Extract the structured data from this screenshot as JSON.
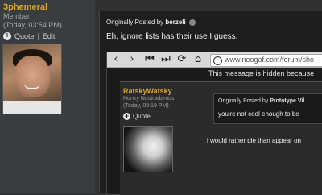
{
  "author": {
    "username": "3phemeral",
    "title": "Member",
    "time": "(Today, 03:54 PM)",
    "quote_label": "Quote",
    "separator": "|",
    "edit_label": "Edit"
  },
  "post": {
    "quote_header_prefix": "Originally Posted by",
    "quote_author": "berzeli",
    "body_text": "Eh, ignore lists has their use I guess."
  },
  "embedded": {
    "browser": {
      "url": "www.neogaf.com/forum/sho",
      "icons": [
        "back-icon",
        "forward-icon",
        "skip-back-icon",
        "skip-forward-icon",
        "refresh-icon",
        "home-icon",
        "globe-icon"
      ]
    },
    "hidden_message": "This message is hidden because",
    "inner_post": {
      "username": "RatskyWatsky",
      "title": "Hunky Nostradamus",
      "time": "(Today, 09:19 PM)",
      "quote_label": "Quote",
      "quote_header_prefix": "Originally Posted by",
      "quote_author": "Prototype Vil",
      "quote_text": "you're not cool enough to be",
      "reply_text": "i would rather die than appear on"
    }
  },
  "colors": {
    "username": "#d9a531",
    "page_bg": "#2f3133",
    "post_bg": "#1d1e1f"
  }
}
